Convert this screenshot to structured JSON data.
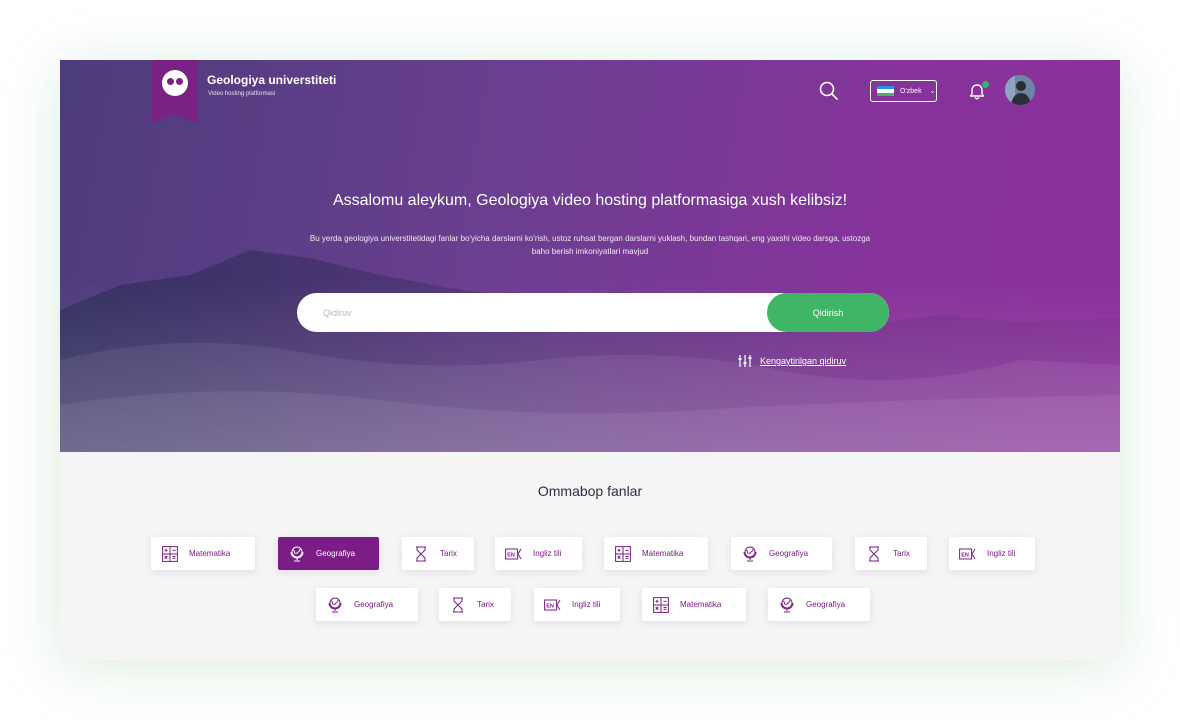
{
  "header": {
    "brand_title": "Geologiya universtiteti",
    "brand_subtitle": "Video hosting platformasi",
    "language": "O'zbek",
    "icons": [
      "search-icon",
      "bell-icon",
      "chevron-down-icon"
    ]
  },
  "hero": {
    "title": "Assalomu aleykum, Geologiya video hosting platformasiga xush kelibsiz!",
    "description": "Bu yerda geologiya universtitetidagi fanlar bo'yicha darslarni ko'rish, ustoz ruhsat bergan darslarni yuklash, bundan tashqari, eng yaxshi video darsga, ustozga baho berish imkoniyatlari mavjud",
    "search_placeholder": "Qidiruv",
    "search_button": "Qidirish",
    "advanced_search": "Kengaytirilgan qidiruv"
  },
  "popular": {
    "title": "Ommabop fanlar",
    "chips": [
      {
        "label": "Matematika",
        "icon": "calculator-icon",
        "active": false
      },
      {
        "label": "Geografiya",
        "icon": "globe-icon",
        "active": true
      },
      {
        "label": "Tarix",
        "icon": "hourglass-icon",
        "active": false
      },
      {
        "label": "Ingliz tili",
        "icon": "english-icon",
        "active": false
      },
      {
        "label": "Matematika",
        "icon": "calculator-icon",
        "active": false
      },
      {
        "label": "Geografiya",
        "icon": "globe-icon",
        "active": false
      },
      {
        "label": "Tarix",
        "icon": "hourglass-icon",
        "active": false
      },
      {
        "label": "Ingliz tili",
        "icon": "english-icon",
        "active": false
      },
      {
        "label": "Geografiya",
        "icon": "globe-icon",
        "active": false
      },
      {
        "label": "Tarix",
        "icon": "hourglass-icon",
        "active": false
      },
      {
        "label": "Ingliz tili",
        "icon": "english-icon",
        "active": false
      },
      {
        "label": "Matematika",
        "icon": "calculator-icon",
        "active": false
      },
      {
        "label": "Geografiya",
        "icon": "globe-icon",
        "active": false
      }
    ]
  },
  "colors": {
    "accent": "#7a1d86",
    "green": "#3fb565",
    "hero_left": "#4c3c7c",
    "hero_right": "#8b2f9c"
  }
}
